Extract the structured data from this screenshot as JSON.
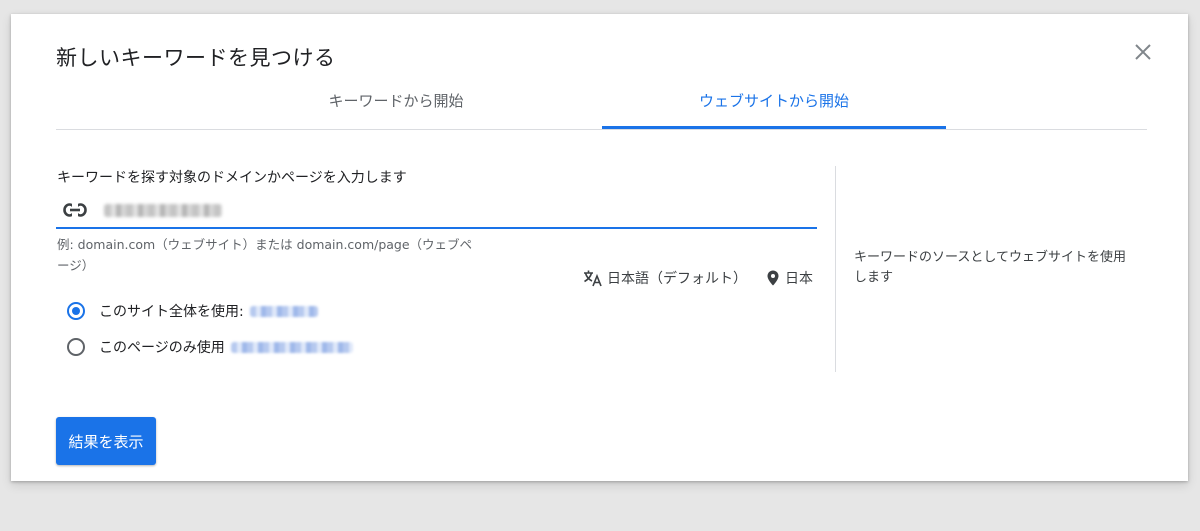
{
  "dialog": {
    "title": "新しいキーワードを見つける",
    "close_icon": "close-icon"
  },
  "tabs": [
    {
      "label": "キーワードから開始",
      "active": false
    },
    {
      "label": "ウェブサイトから開始",
      "active": true
    }
  ],
  "form": {
    "prompt": "キーワードを探す対象のドメインかページを入力します",
    "url_icon": "link-icon",
    "url_value": "(redacted)",
    "helper": "例: domain.com（ウェブサイト）または domain.com/page（ウェブページ）",
    "language": {
      "icon": "translate-icon",
      "label": "日本語（デフォルト）"
    },
    "location": {
      "icon": "location-pin-icon",
      "label": "日本"
    },
    "radios": [
      {
        "label": "このサイト全体を使用:",
        "checked": true,
        "value": "(redacted)"
      },
      {
        "label": "このページのみ使用",
        "checked": false,
        "value": "(redacted)"
      }
    ]
  },
  "side_text": "キーワードのソースとしてウェブサイトを使用します",
  "submit_label": "結果を表示",
  "colors": {
    "accent": "#1a73e8",
    "text_primary": "#202124",
    "text_secondary": "#5f6368",
    "divider": "#dadce0",
    "backdrop": "#e6e6e6"
  }
}
